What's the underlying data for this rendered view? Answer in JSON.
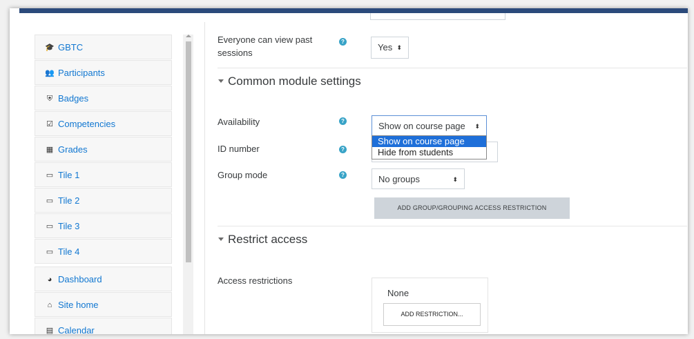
{
  "sidebar": {
    "items": [
      {
        "label": "GBTC",
        "icon": "graduation-cap-icon",
        "glyph": "🎓"
      },
      {
        "label": "Participants",
        "icon": "users-icon",
        "glyph": "👥"
      },
      {
        "label": "Badges",
        "icon": "shield-icon",
        "glyph": "⛨"
      },
      {
        "label": "Competencies",
        "icon": "check-square-icon",
        "glyph": "☑"
      },
      {
        "label": "Grades",
        "icon": "table-icon",
        "glyph": "▦"
      },
      {
        "label": "Tile 1",
        "icon": "folder-icon",
        "glyph": "▭"
      },
      {
        "label": "Tile 2",
        "icon": "folder-icon",
        "glyph": "▭"
      },
      {
        "label": "Tile 3",
        "icon": "folder-icon",
        "glyph": "▭"
      },
      {
        "label": "Tile 4",
        "icon": "folder-icon",
        "glyph": "▭"
      },
      {
        "label": "Dashboard",
        "icon": "dashboard-icon",
        "glyph": "◕"
      },
      {
        "label": "Site home",
        "icon": "home-icon",
        "glyph": "⌂"
      },
      {
        "label": "Calendar",
        "icon": "calendar-icon",
        "glyph": "▤"
      }
    ]
  },
  "form": {
    "past_sessions": {
      "label_line1": "Everyone can view past",
      "label_line2": "sessions",
      "value": "Yes"
    },
    "common_module": {
      "heading": "Common module settings",
      "availability": {
        "label": "Availability",
        "value": "Show on course page",
        "options": [
          "Show on course page",
          "Hide from students"
        ]
      },
      "id_number": {
        "label": "ID number",
        "value": ""
      },
      "group_mode": {
        "label": "Group mode",
        "value": "No groups"
      },
      "add_group_button": "ADD GROUP/GROUPING ACCESS RESTRICTION"
    },
    "restrict_access": {
      "heading": "Restrict access",
      "access_label": "Access restrictions",
      "none_text": "None",
      "add_restriction_button": "ADD RESTRICTION..."
    }
  },
  "help_icon_glyph": "?",
  "select_arrow_glyph": "⬍",
  "colors": {
    "link": "#1177d1",
    "topbar": "#2b4a7b",
    "help": "#38a3c7",
    "selected_option": "#1e6fd9"
  }
}
